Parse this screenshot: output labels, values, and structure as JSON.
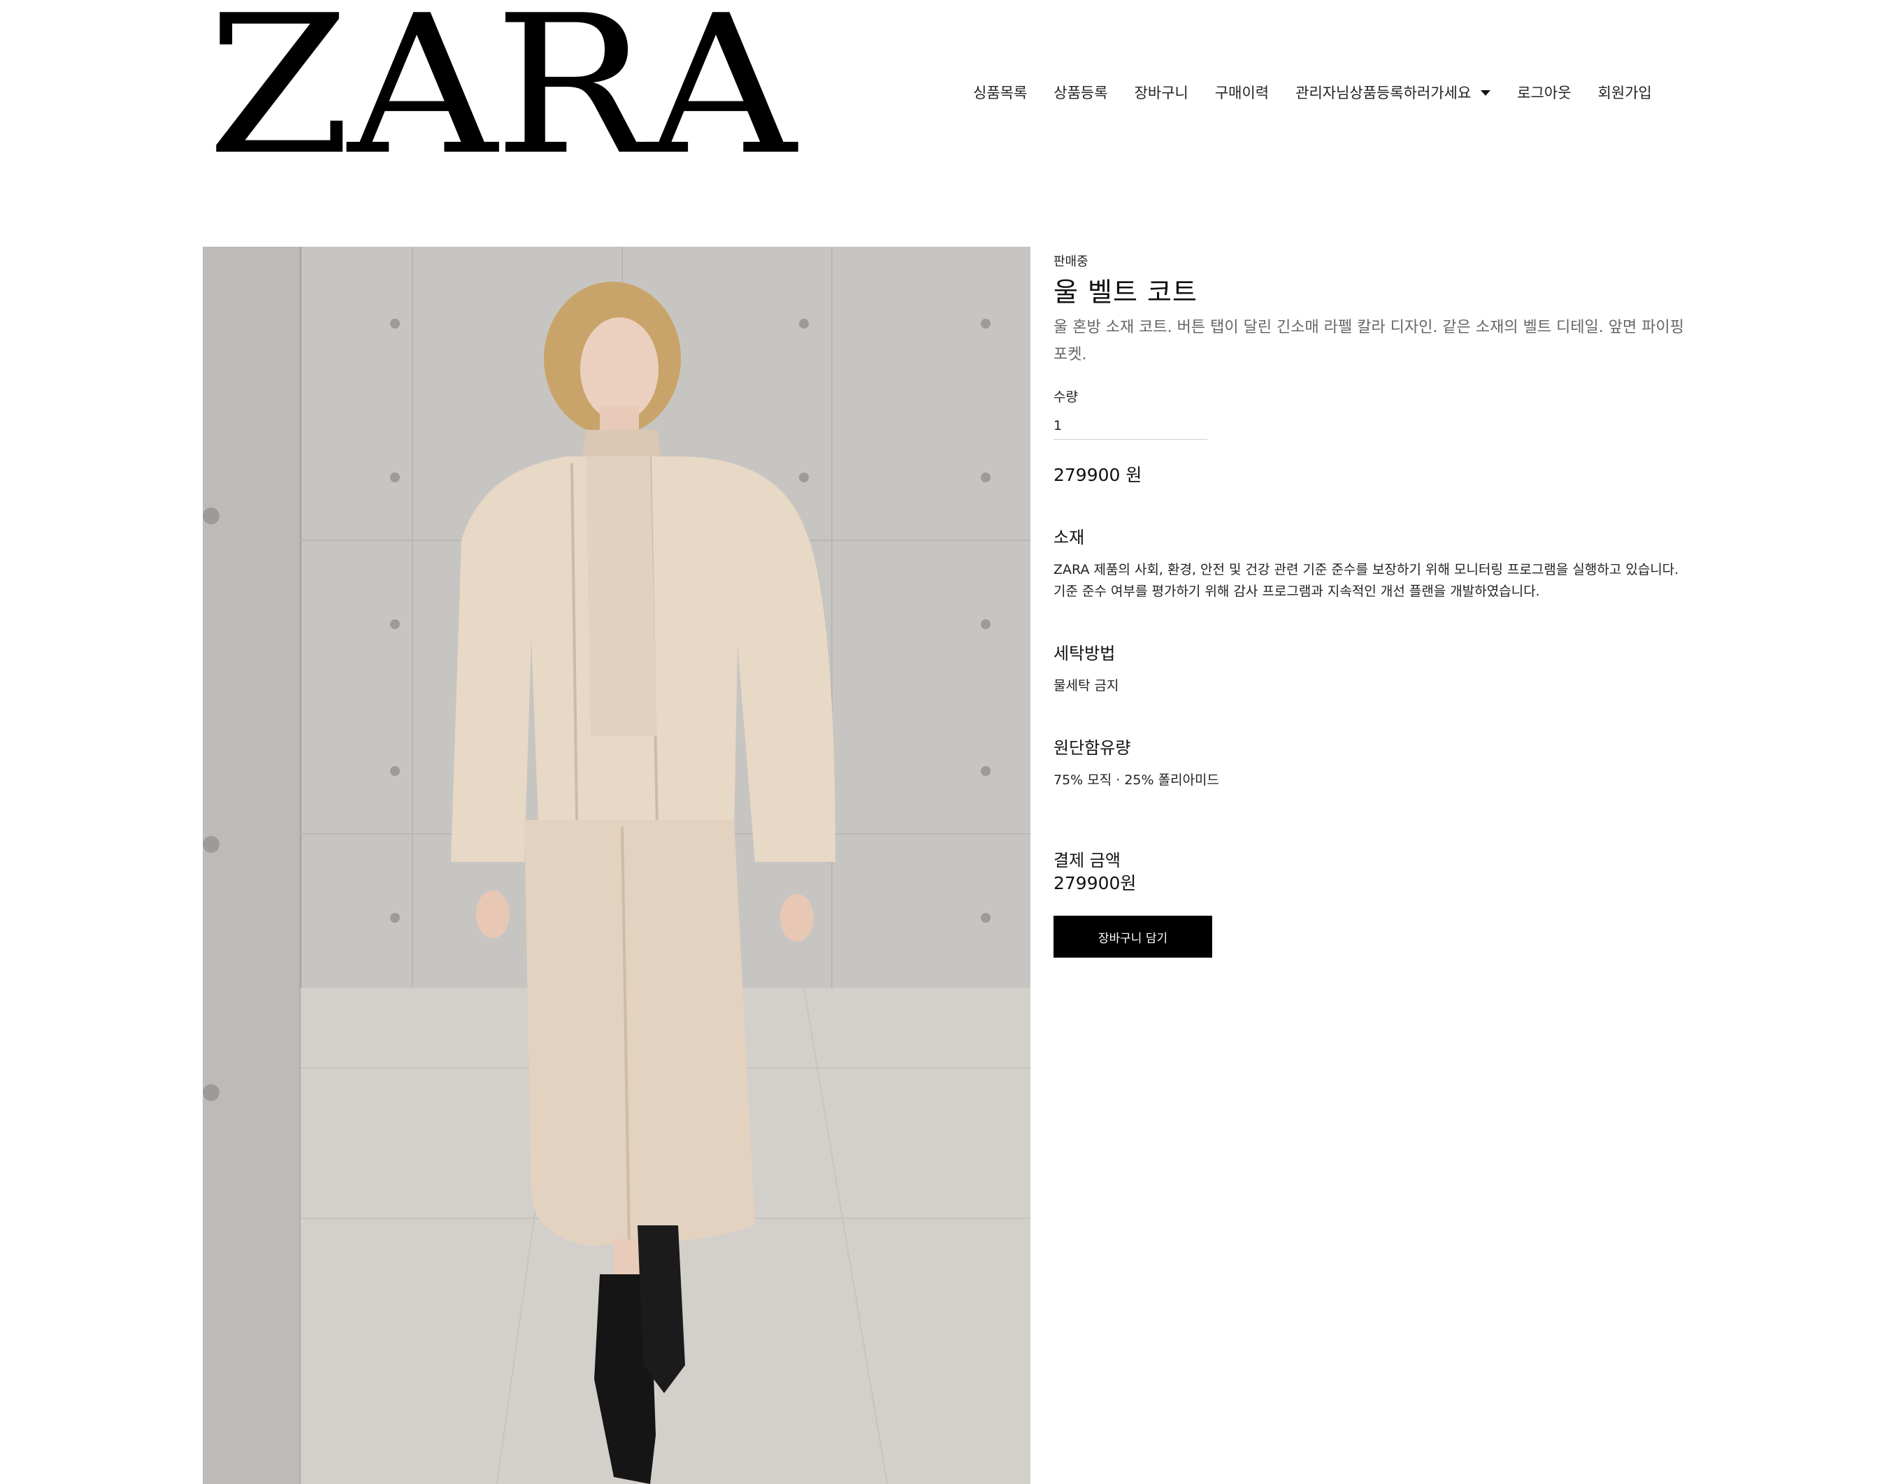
{
  "header": {
    "logo": "ZARA",
    "nav": [
      "싱품목록",
      "상품등록",
      "장바구니",
      "구매이력",
      "관리자님상품등록하러가세요",
      "로그아웃",
      "회원가입"
    ]
  },
  "product": {
    "image_alt": "model wearing beige padded jacket and skirt with black boots",
    "status": "판매중",
    "name": "울 벨트 코트",
    "description": "울 혼방 소재 코트. 버튼 탭이 달린 긴소매 라펠 칼라 디자인. 같은 소재의 벨트 디테일. 앞면 파이핑 포켓.",
    "quantity_label": "수량",
    "quantity_value": "1",
    "price": "279900 원",
    "sections": {
      "material_title": "소재",
      "material_text_1": "ZARA 제품의 사회, 환경, 안전 및 건강 관련 기준 준수를 보장하기 위해 모니터링 프로그램을 실행하고 있습니다.",
      "material_text_2": "기준 준수 여부를 평가하기 위해 감사 프로그램과 지속적인 개선 플랜을 개발하였습니다.",
      "care_title": "세탁방법",
      "care_text": "물세탁 금지",
      "composition_title": "원단함유량",
      "composition_text": "75% 모직 · 25% 폴리아미드"
    },
    "total_label": "결제 금액",
    "total_value": "279900원",
    "cart_button": "장바구니 담기"
  },
  "colors": {
    "button_bg": "#000000",
    "button_text": "#ffffff",
    "garment": "#e6d7c6"
  }
}
